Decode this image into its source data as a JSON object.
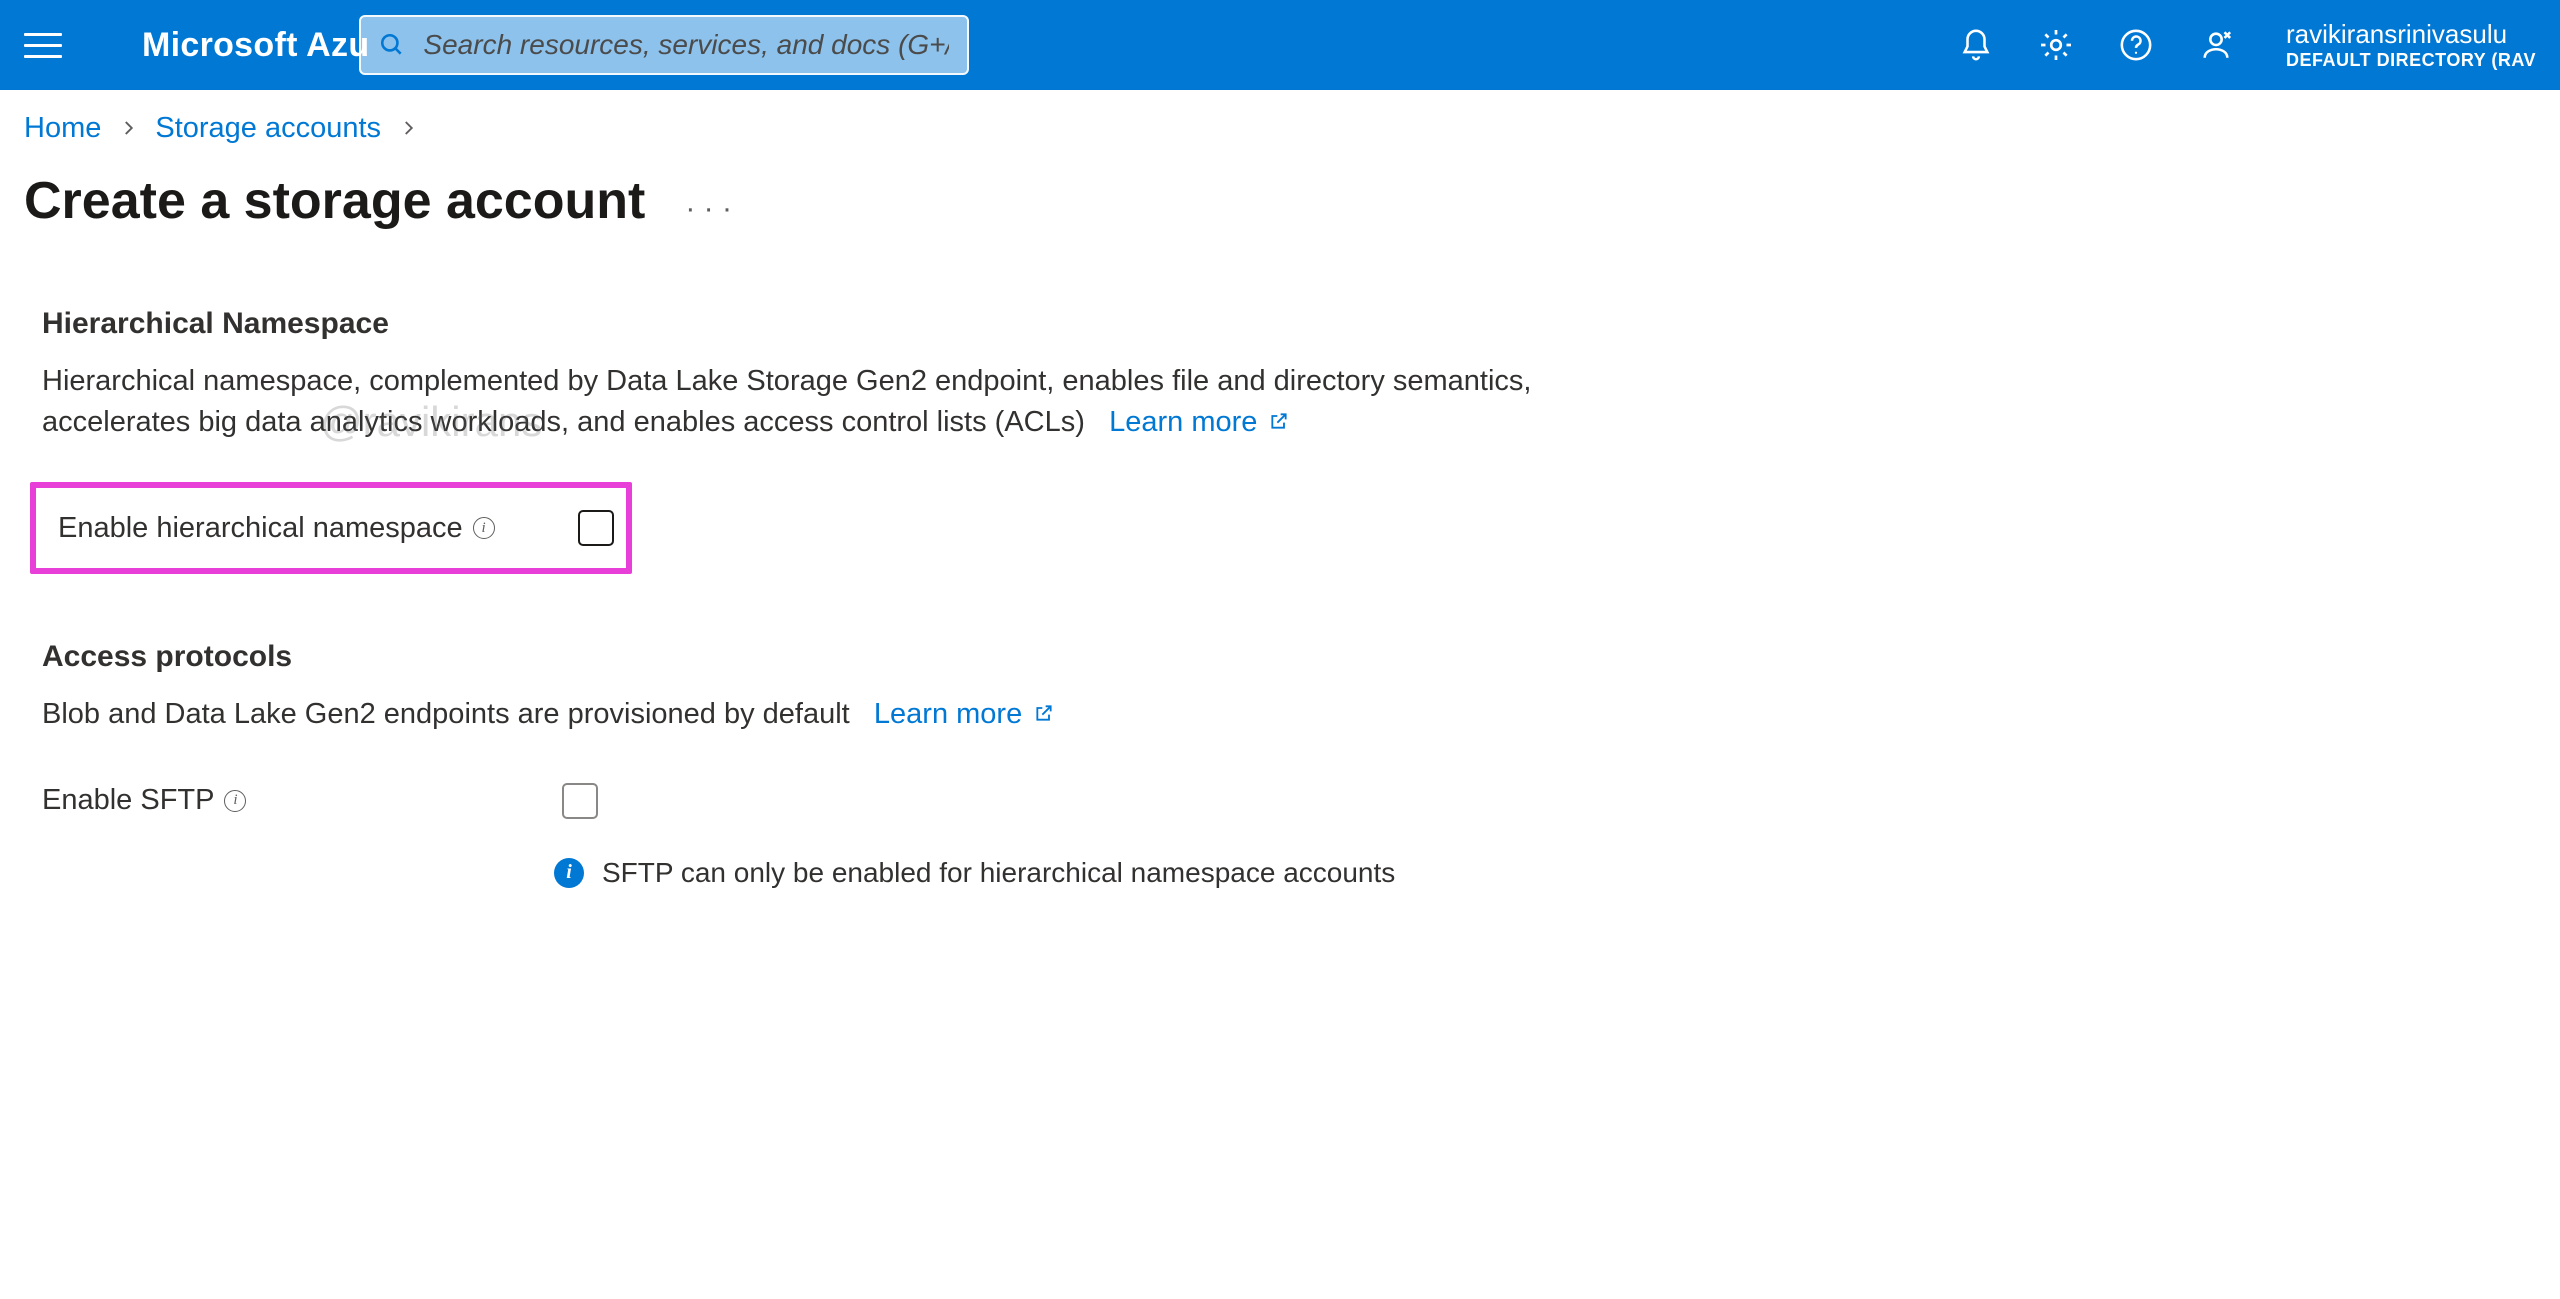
{
  "topbar": {
    "brand": "Microsoft Azu",
    "search_placeholder": "Search resources, services, and docs (G+/)",
    "account_name": "ravikiransrinivasulu",
    "account_directory": "DEFAULT DIRECTORY (RAV"
  },
  "breadcrumb": {
    "home": "Home",
    "storage_accounts": "Storage accounts"
  },
  "page_title": "Create a storage account",
  "watermark": "@ravikirans",
  "hierarchical": {
    "heading": "Hierarchical Namespace",
    "desc": "Hierarchical namespace, complemented by Data Lake Storage Gen2 endpoint, enables file and directory semantics, accelerates big data analytics workloads, and enables access control lists (ACLs)",
    "learn_more": "Learn more",
    "option_label": "Enable hierarchical namespace"
  },
  "access": {
    "heading": "Access protocols",
    "desc": "Blob and Data Lake Gen2 endpoints are provisioned by default",
    "learn_more": "Learn more",
    "sftp_label": "Enable SFTP",
    "sftp_note": "SFTP can only be enabled for hierarchical namespace accounts"
  }
}
